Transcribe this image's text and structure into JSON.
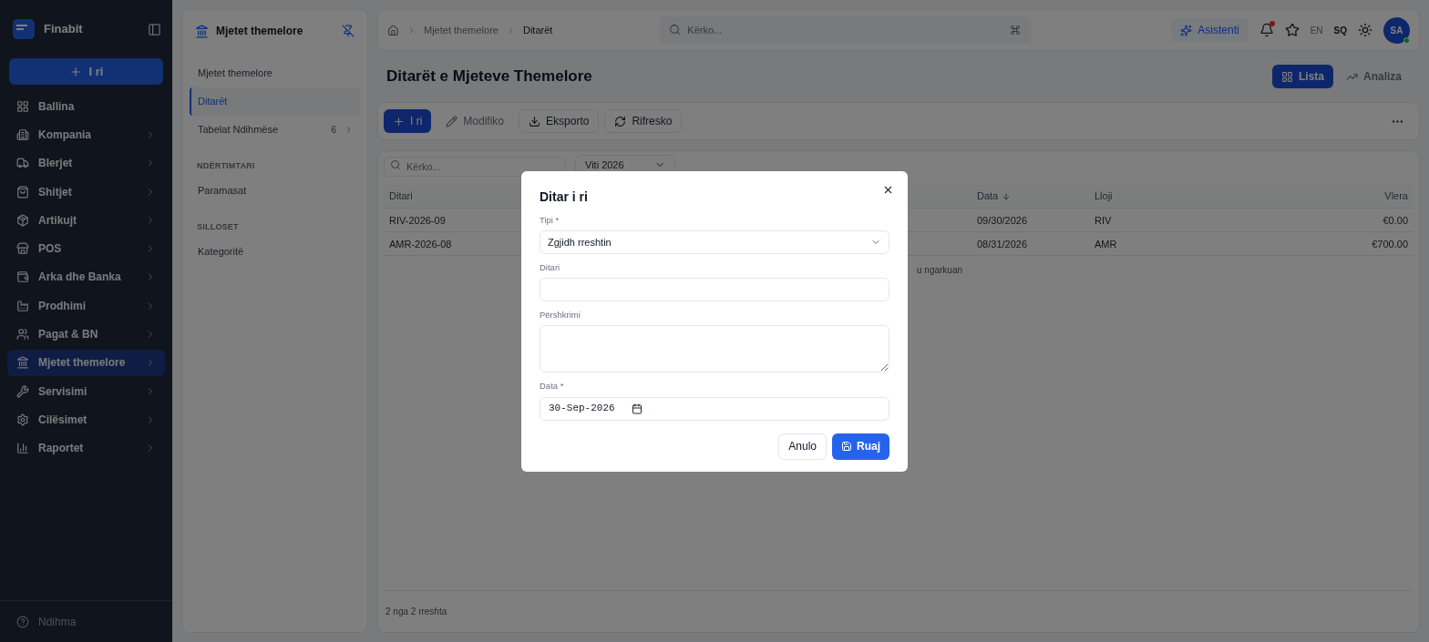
{
  "sidebar": {
    "brand": "Finabit",
    "new_button": "I ri",
    "items": [
      {
        "label": "Ballina",
        "selected": false,
        "chevron": false
      },
      {
        "label": "Kompania",
        "selected": false,
        "chevron": true
      },
      {
        "label": "Blerjet",
        "selected": false,
        "chevron": true
      },
      {
        "label": "Shitjet",
        "selected": false,
        "chevron": true
      },
      {
        "label": "Artikujt",
        "selected": false,
        "chevron": true
      },
      {
        "label": "POS",
        "selected": false,
        "chevron": true
      },
      {
        "label": "Arka dhe Banka",
        "selected": false,
        "chevron": true
      },
      {
        "label": "Prodhimi",
        "selected": false,
        "chevron": true
      },
      {
        "label": "Pagat & BN",
        "selected": false,
        "chevron": true
      },
      {
        "label": "Mjetet themelore",
        "selected": true,
        "chevron": true
      },
      {
        "label": "Servisimi",
        "selected": false,
        "chevron": true
      },
      {
        "label": "Cilësimet",
        "selected": false,
        "chevron": true
      },
      {
        "label": "Raportet",
        "selected": false,
        "chevron": true
      }
    ],
    "footer": "Ndihma"
  },
  "subnav": {
    "title": "Mjetet themelore",
    "groups": [
      {
        "items": [
          {
            "label": "Mjetet themelore",
            "selected": false
          },
          {
            "label": "Ditarët",
            "selected": true
          },
          {
            "label": "Tabelat Ndihmëse",
            "count": "6",
            "selected": false
          }
        ]
      },
      {
        "heading": "NDËRTIMTARI",
        "items": [
          {
            "label": "Paramasat",
            "selected": false
          }
        ]
      },
      {
        "heading": "SILLOSET",
        "items": [
          {
            "label": "Kategoritë",
            "selected": false
          }
        ]
      }
    ]
  },
  "topbar": {
    "breadcrumbs": [
      "Mjetet themelore",
      "Ditarët"
    ],
    "search": {
      "placeholder": "Kërko..."
    },
    "assistant": "Asistenti",
    "unread": true,
    "languages": [
      {
        "label": "EN",
        "selected": false
      },
      {
        "label": "SQ",
        "selected": true
      }
    ],
    "avatar": "SA",
    "online": true
  },
  "page": {
    "title": "Ditarët e Mjeteve Themelore",
    "views": [
      {
        "label": "Lista",
        "selected": true
      },
      {
        "label": "Analiza",
        "selected": false
      }
    ],
    "toolbar": [
      {
        "label": "I ri",
        "kind": "primary",
        "disabled": false
      },
      {
        "label": "Modifiko",
        "kind": "edit",
        "disabled": true
      },
      {
        "label": "Eksporto",
        "kind": "export",
        "disabled": false
      },
      {
        "label": "Rifresko",
        "kind": "refresh",
        "disabled": false
      }
    ]
  },
  "table": {
    "search": {
      "placeholder": "Kërko..."
    },
    "year_filter": "Viti 2026",
    "columns": [
      {
        "label": "Ditari",
        "sorted": false
      },
      {
        "label": "Data",
        "sorted": true
      },
      {
        "label": "Lloji",
        "sorted": false
      },
      {
        "label": "Vlera",
        "sorted": false
      }
    ],
    "rows": [
      [
        "RIV-2026-09",
        "09/30/2026",
        "RIV",
        "€0.00"
      ],
      [
        "AMR-2026-08",
        "08/31/2026",
        "AMR",
        "€700.00"
      ]
    ],
    "status": "u ngarkuan",
    "footer": "2 nga 2 rreshta"
  },
  "dialog": {
    "title": "Ditar i ri",
    "fields": [
      {
        "label": "Tipi *",
        "kind": "select",
        "value": "Zgjidh rreshtin"
      },
      {
        "label": "Ditari",
        "kind": "text"
      },
      {
        "label": "Përshkrimi",
        "kind": "textarea"
      },
      {
        "label": "Data *",
        "kind": "date",
        "value": "30-Sep-2026"
      }
    ],
    "buttons": [
      {
        "label": "Anulo",
        "kind": "secondary"
      },
      {
        "label": "Ruaj",
        "kind": "primary"
      }
    ]
  }
}
